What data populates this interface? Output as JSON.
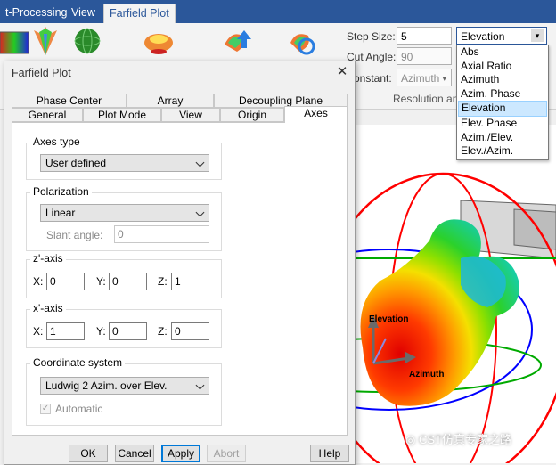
{
  "ribbon": {
    "tabs": [
      "t-Processing",
      "View",
      "Farfield Plot"
    ],
    "active_tab": "Farfield Plot",
    "step_size_label": "Step Size:",
    "step_size_value": "5",
    "cut_angle_label": "Cut Angle:",
    "cut_angle_value": "90",
    "constant_label": "onstant:",
    "constant_value": "Azimuth",
    "group_label": "Resolution and",
    "plot_mode_value": "Elevation"
  },
  "plot_mode_dropdown": {
    "options": [
      "Abs",
      "Axial Ratio",
      "Azimuth",
      "Azim. Phase",
      "Elevation",
      "Elev. Phase",
      "Azim./Elev.",
      "Elev./Azim."
    ],
    "selected": "Elevation"
  },
  "viewport": {
    "axis_elevation": "Elevation",
    "axis_azimuth": "Azimuth",
    "watermark": "CST仿真专家之路"
  },
  "dialog": {
    "title": "Farfield Plot",
    "tabs_row1": [
      "Phase Center",
      "Array",
      "Decoupling Plane"
    ],
    "tabs_row2": [
      "General",
      "Plot Mode",
      "View",
      "Origin",
      "Axes"
    ],
    "active_tab": "Axes",
    "axes_type": {
      "label": "Axes type",
      "value": "User defined"
    },
    "polarization": {
      "label": "Polarization",
      "value": "Linear",
      "slant_label": "Slant angle:",
      "slant_value": "0"
    },
    "z_axis": {
      "label": "z'-axis",
      "x_label": "X:",
      "x": "0",
      "y_label": "Y:",
      "y": "0",
      "z_label": "Z:",
      "z": "1"
    },
    "x_axis": {
      "label": "x'-axis",
      "x_label": "X:",
      "x": "1",
      "y_label": "Y:",
      "y": "0",
      "z_label": "Z:",
      "z": "0"
    },
    "coordinate_system": {
      "label": "Coordinate system",
      "value": "Ludwig 2 Azim. over Elev.",
      "automatic_label": "Automatic",
      "automatic_checked": true
    },
    "buttons": {
      "ok": "OK",
      "cancel": "Cancel",
      "apply": "Apply",
      "abort": "Abort",
      "help": "Help"
    }
  }
}
